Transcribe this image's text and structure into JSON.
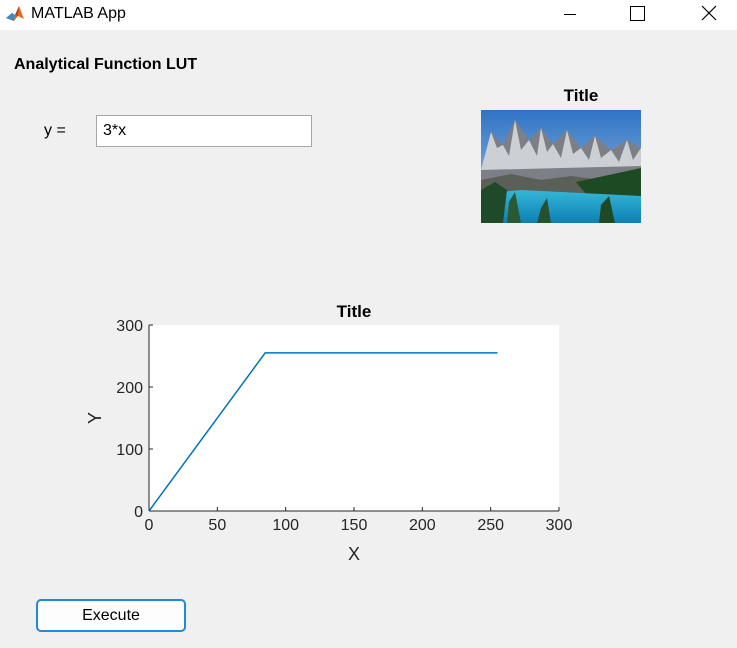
{
  "window": {
    "title": "MATLAB App",
    "icon": "matlab-logo-icon",
    "controls": [
      "minimize-icon",
      "maximize-icon",
      "close-icon"
    ]
  },
  "heading": "Analytical Function LUT",
  "equation": {
    "label": "y =",
    "value": "3*x"
  },
  "image_panel": {
    "title": "Title",
    "image": "mountain-lake-photo"
  },
  "execute_label": "Execute",
  "colors": {
    "line": "#0072bd",
    "button_border": "#1f8ad8",
    "background": "#f0f0f0"
  },
  "chart_data": {
    "type": "line",
    "title": "Title",
    "xlabel": "X",
    "ylabel": "Y",
    "xlim": [
      0,
      300
    ],
    "ylim": [
      0,
      300
    ],
    "xticks": [
      0,
      50,
      100,
      150,
      200,
      250,
      300
    ],
    "yticks": [
      0,
      100,
      200,
      300
    ],
    "grid": false,
    "series": [
      {
        "x": [
          0,
          85,
          255
        ],
        "y": [
          0,
          255,
          255
        ]
      }
    ]
  }
}
